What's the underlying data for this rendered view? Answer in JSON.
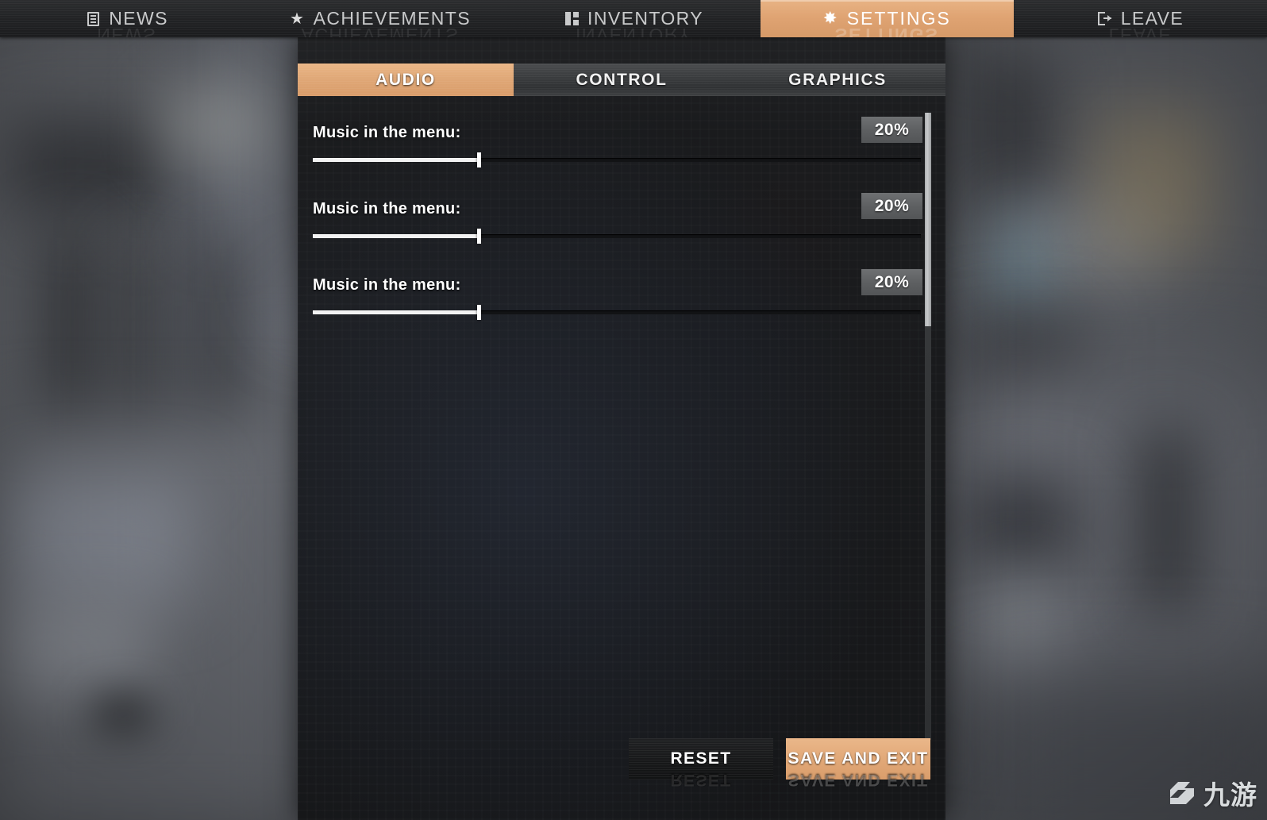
{
  "nav": {
    "tabs": [
      {
        "label": "NEWS",
        "icon": "document-icon",
        "active": false
      },
      {
        "label": "ACHIEVEMENTS",
        "icon": "star-icon",
        "active": false
      },
      {
        "label": "INVENTORY",
        "icon": "grid-icon",
        "active": false
      },
      {
        "label": "SETTINGS",
        "icon": "gear-icon",
        "active": true
      },
      {
        "label": "LEAVE",
        "icon": "exit-icon",
        "active": false
      }
    ]
  },
  "settings": {
    "subtabs": [
      {
        "label": "AUDIO",
        "active": true
      },
      {
        "label": "CONTROL",
        "active": false
      },
      {
        "label": "GRAPHICS",
        "active": false
      }
    ],
    "sliders": [
      {
        "label": "Music in the menu:",
        "value": "20%",
        "percent": 27
      },
      {
        "label": "Music in the menu:",
        "value": "20%",
        "percent": 27
      },
      {
        "label": "Music in the menu:",
        "value": "20%",
        "percent": 27
      }
    ],
    "footer": {
      "reset_label": "RESET",
      "save_label": "SAVE AND EXIT"
    },
    "scroll": {
      "thumb_percent": 34
    }
  },
  "watermark": {
    "text": "九游"
  },
  "colors": {
    "accent": "#e0a877",
    "accent_dark": "#d69a68",
    "panel_bg": "#18191b",
    "nav_bg": "#212224",
    "value_box": "#5e6062",
    "track": "#121315",
    "track_fill": "#f2f2f2"
  }
}
